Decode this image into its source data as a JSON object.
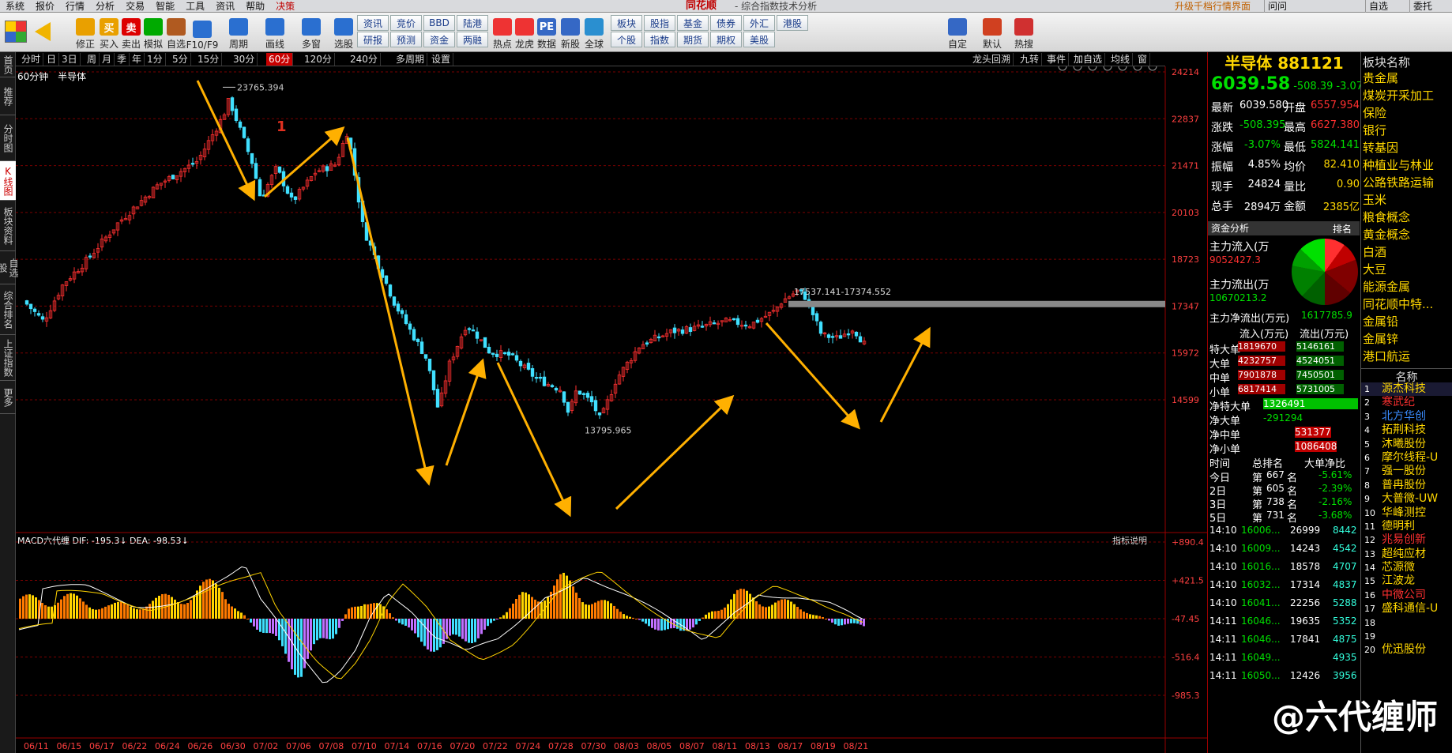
{
  "menubar": {
    "items": [
      "系统",
      "报价",
      "行情",
      "分析",
      "交易",
      "智能",
      "工具",
      "资讯",
      "帮助",
      "决策"
    ],
    "brand": "同花顺",
    "subtitle": "- 综合指数技术分析",
    "upgrade": "升级千档行情界面",
    "help": "问问",
    "buttons": [
      "自选",
      "委托"
    ]
  },
  "toolbar": {
    "left": [
      {
        "label": "修正",
        "icon": "arrows-icon"
      },
      {
        "label": "买入",
        "icon": "buy-icon",
        "glyph": "买"
      },
      {
        "label": "卖出",
        "icon": "sell-icon",
        "glyph": "卖"
      },
      {
        "label": "模拟",
        "icon": "hammer-icon"
      },
      {
        "label": "自选",
        "icon": "star-icon"
      },
      {
        "label": "F10/F9",
        "icon": "f10-icon"
      },
      {
        "label": "周期",
        "icon": "clock-icon"
      },
      {
        "label": "画线",
        "icon": "pen-icon"
      },
      {
        "label": "多窗",
        "icon": "grid-icon"
      },
      {
        "label": "选股",
        "icon": "gauge-icon"
      }
    ],
    "grid1": [
      [
        "资讯",
        "竞价",
        "BBD",
        "陆港"
      ],
      [
        "研报",
        "预测",
        "资金",
        "两融"
      ]
    ],
    "mid": [
      {
        "label": "热点",
        "icon": "fire-icon"
      },
      {
        "label": "龙虎",
        "icon": "dragon-icon"
      },
      {
        "label": "数据",
        "icon": "pe-icon",
        "glyph": "PE"
      },
      {
        "label": "新股",
        "icon": "newstock-icon"
      },
      {
        "label": "全球",
        "icon": "globe-icon"
      }
    ],
    "grid2": [
      [
        "板块",
        "股指",
        "基金",
        "债券",
        "外汇",
        "港股"
      ],
      [
        "个股",
        "指数",
        "期货",
        "期权",
        "美股",
        ""
      ]
    ],
    "right": [
      {
        "label": "自定",
        "icon": "custom-icon"
      },
      {
        "label": "默认",
        "icon": "home-icon"
      },
      {
        "label": "热搜",
        "icon": "hotsearch-icon"
      }
    ]
  },
  "leftnav": [
    "首页",
    "推荐",
    "分时图",
    "K线图",
    "板块资料",
    "自选股",
    "综合排名",
    "上证指数",
    "更多"
  ],
  "periodbar": {
    "items": [
      "分时",
      "日",
      "3日",
      "周",
      "月",
      "季",
      "年",
      "1分",
      "5分",
      "15分",
      "30分",
      "60分",
      "120分",
      "240分",
      "多周期",
      "设置"
    ],
    "selected": "60分",
    "right": [
      "龙头回溯",
      "九转",
      "事件",
      "加自选",
      "均线",
      "窗"
    ]
  },
  "chart": {
    "period": "60分钟",
    "name": "半导体",
    "price_axis": [
      "24214",
      "22837",
      "21471",
      "20103",
      "18723",
      "17347",
      "15972",
      "14599"
    ],
    "high_label": "23765.394",
    "low_label": "13795.965",
    "zone_label": "17537.141-17374.552",
    "wave_label": "1",
    "macd_title": "MACD六代缠 DIF: -195.3↓ DEA: -98.53↓",
    "macd_help": "指标说明",
    "macd_axis": [
      "+890.4",
      "+421.5",
      "-47.45",
      "-516.4",
      "-985.3"
    ],
    "dates": [
      "06/11",
      "06/15",
      "06/17",
      "06/22",
      "06/24",
      "06/26",
      "06/30",
      "07/02",
      "07/06",
      "07/08",
      "07/10",
      "07/14",
      "07/16",
      "07/20",
      "07/22",
      "07/24",
      "07/28",
      "07/30",
      "08/03",
      "08/05",
      "08/07",
      "08/11",
      "08/13",
      "08/17",
      "08/19",
      "08/21"
    ]
  },
  "quote": {
    "title": "半导体 881121",
    "price": "6039.58",
    "change": "-508.39",
    "pct": "-3.07%",
    "rows": [
      [
        "最新",
        "6039.580",
        "开盘",
        "6557.954"
      ],
      [
        "涨跌",
        "-508.395",
        "最高",
        "6627.380"
      ],
      [
        "涨幅",
        "-3.07%",
        "最低",
        "5824.141"
      ],
      [
        "振幅",
        "4.85%",
        "均价",
        "82.410"
      ],
      [
        "现手",
        "24824",
        "量比",
        "0.90"
      ],
      [
        "总手",
        "2894万",
        "金额",
        "2385亿"
      ]
    ],
    "fund_title": "资金分析",
    "fund_rank": "排名",
    "inflow_label": "主力流入(万",
    "inflow": "9052427.3",
    "outflow_label": "主力流出(万",
    "outflow": "10670213.2",
    "net_label": "主力净流出(万元)",
    "net": "1617785.9",
    "pie": [
      "13%",
      "10%",
      "9%",
      "9%",
      "16%",
      "17%",
      "12%",
      "14%"
    ],
    "flow_head": [
      "流入(万元)",
      "流出(万元)"
    ],
    "flows": [
      [
        "特大单",
        "1819670",
        "5146161"
      ],
      [
        "大单",
        "4232757",
        "4524051"
      ],
      [
        "中单",
        "7901878",
        "7450501"
      ],
      [
        "小单",
        "6817414",
        "5731005"
      ]
    ],
    "nets": [
      [
        "净特大单",
        "1326491"
      ],
      [
        "净大单",
        "-291294"
      ],
      [
        "净中单",
        "531377"
      ],
      [
        "净小单",
        "1086408"
      ]
    ],
    "rank_head": [
      "时间",
      "总排名",
      "大单净比"
    ],
    "ranks": [
      [
        "今日",
        "第",
        "667",
        "名",
        "-5.61%"
      ],
      [
        "2日",
        "第",
        "605",
        "名",
        "-2.39%"
      ],
      [
        "3日",
        "第",
        "738",
        "名",
        "-2.16%"
      ],
      [
        "5日",
        "第",
        "731",
        "名",
        "-3.68%"
      ]
    ],
    "ticks": [
      [
        "14:10",
        "16006...",
        "26999",
        "8442"
      ],
      [
        "14:10",
        "16009...",
        "14243",
        "4542"
      ],
      [
        "14:10",
        "16016...",
        "18578",
        "4707"
      ],
      [
        "14:10",
        "16032...",
        "17314",
        "4837"
      ],
      [
        "14:10",
        "16041...",
        "22256",
        "5288"
      ],
      [
        "14:11",
        "16046...",
        "19635",
        "5352"
      ],
      [
        "14:11",
        "16046...",
        "17841",
        "4875"
      ],
      [
        "14:11",
        "16049...",
        "",
        "4935"
      ],
      [
        "14:11",
        "16050...",
        "12426",
        "3956"
      ]
    ]
  },
  "boards": {
    "title": "板块名称",
    "items": [
      "贵金属",
      "煤炭开采加工",
      "保险",
      "银行",
      "转基因",
      "种植业与林业",
      "公路铁路运输",
      "玉米",
      "粮食概念",
      "黄金概念",
      "白酒",
      "大豆",
      "能源金属",
      "同花顺中特...",
      "金属铅",
      "金属锌",
      "港口航运"
    ],
    "stock_head": "名称",
    "stocks": [
      "源杰科技",
      "寒武纪",
      "北方华创",
      "拓荆科技",
      "沐曦股份",
      "摩尔线程-U",
      "强一股份",
      "普冉股份",
      "大普微-UW",
      "华峰测控",
      "德明利",
      "兆易创新",
      "超纯应材",
      "芯源微",
      "江波龙",
      "中微公司",
      "盛科通信-U",
      "",
      "",
      "优迅股份"
    ]
  },
  "watermark": "@六代缠师"
}
